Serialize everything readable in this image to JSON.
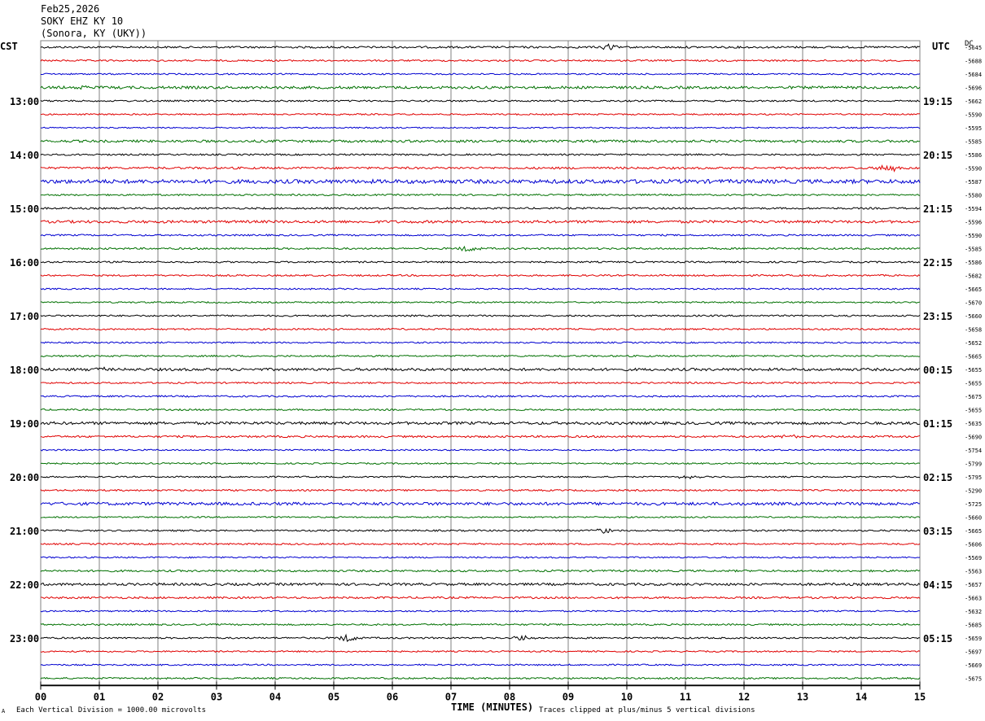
{
  "header": {
    "date": "Feb25,2026",
    "station": "SOKY EHZ KY 10",
    "location": "(Sonora, KY (UKY))"
  },
  "left_timezone": "CST",
  "right_timezone": "UTC",
  "dc_label": "DC",
  "footer": {
    "scale_note": "Each Vertical Division = 1000.00 microvolts",
    "clip_note": "Traces clipped at plus/minus 5 vertical divisions",
    "corner_mark": "A"
  },
  "colors": {
    "trace_cycle": [
      "#000000",
      "#e00000",
      "#0000d0",
      "#007000"
    ],
    "grid": "#808080",
    "background": "#ffffff"
  },
  "chart_data": {
    "type": "line",
    "subtype": "helicorder",
    "xlabel": "TIME (MINUTES)",
    "xlim": [
      0,
      15
    ],
    "x_ticks": [
      "00",
      "01",
      "02",
      "03",
      "04",
      "05",
      "06",
      "07",
      "08",
      "09",
      "10",
      "11",
      "12",
      "13",
      "14",
      "15"
    ],
    "minutes_per_line": 15,
    "line_count": 48,
    "left_hour_labels": [
      "13:00",
      "14:00",
      "15:00",
      "16:00",
      "17:00",
      "18:00",
      "19:00",
      "20:00",
      "21:00",
      "22:00",
      "23:00"
    ],
    "right_hour_labels": [
      "19:15",
      "20:15",
      "21:15",
      "22:15",
      "23:15",
      "00:15",
      "01:15",
      "02:15",
      "03:15",
      "04:15",
      "05:15"
    ],
    "hour_label_first_line": 4,
    "lines_per_hour": 4,
    "dc_offsets": [
      "-5645",
      "-5688",
      "-5684",
      "-5696",
      "-5662",
      "-5590",
      "-5595",
      "-5585",
      "-5586",
      "-5590",
      "-5587",
      "-5580",
      "-5594",
      "-5596",
      "-5590",
      "-5585",
      "-5586",
      "-5682",
      "-5665",
      "-5670",
      "-5660",
      "-5658",
      "-5652",
      "-5665",
      "-5655",
      "-5655",
      "-5675",
      "-5655",
      "-5635",
      "-5690",
      "-5754",
      "-5799",
      "-5795",
      "-5290",
      "-5725",
      "-5660",
      "-5665",
      "-5606",
      "-5569",
      "-5563",
      "-5657",
      "-5663",
      "-5632",
      "-5685",
      "-5659",
      "-5697",
      "-5669",
      "-5675"
    ],
    "noise_levels": [
      1.2,
      1.0,
      0.9,
      1.6,
      1.0,
      0.9,
      0.8,
      1.5,
      1.0,
      1.3,
      2.4,
      1.0,
      1.1,
      1.6,
      1.0,
      1.1,
      1.0,
      1.0,
      0.9,
      0.9,
      1.0,
      1.0,
      0.9,
      1.0,
      1.6,
      1.0,
      1.0,
      1.0,
      1.7,
      1.2,
      0.9,
      0.9,
      0.9,
      1.0,
      1.8,
      0.9,
      1.0,
      1.0,
      0.9,
      1.2,
      1.5,
      1.2,
      0.9,
      1.0,
      1.0,
      0.9,
      0.9,
      1.0
    ],
    "events": [
      {
        "line": 0,
        "minute": 9.7,
        "amplitude": 4
      },
      {
        "line": 3,
        "minute": 0.7,
        "amplitude": 3
      },
      {
        "line": 9,
        "minute": 14.45,
        "amplitude": 6
      },
      {
        "line": 15,
        "minute": 7.3,
        "amplitude": 4
      },
      {
        "line": 24,
        "minute": 1.0,
        "amplitude": 3
      },
      {
        "line": 29,
        "minute": 12.7,
        "amplitude": 3
      },
      {
        "line": 32,
        "minute": 11.05,
        "amplitude": 3
      },
      {
        "line": 36,
        "minute": 9.6,
        "amplitude": 4
      },
      {
        "line": 44,
        "minute": 5.25,
        "amplitude": 5
      },
      {
        "line": 44,
        "minute": 8.25,
        "amplitude": 4
      }
    ]
  }
}
